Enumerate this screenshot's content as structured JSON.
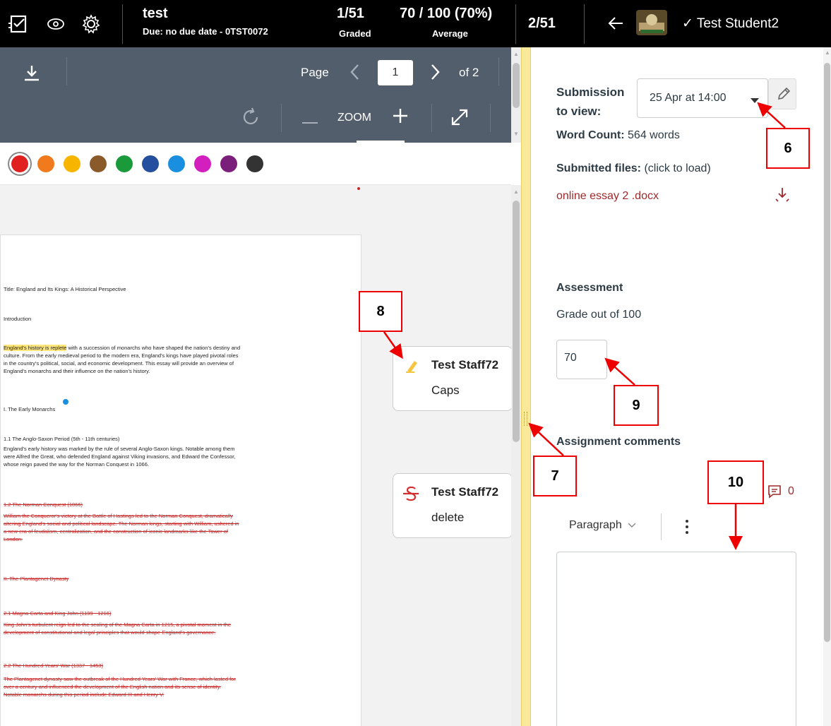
{
  "topbar": {
    "icons": [
      "gradebook-icon",
      "eye-icon",
      "gear-icon"
    ],
    "assignment_title": "test",
    "due_text": "Due: no due date - 0TST0072",
    "graded_count": "1/51",
    "graded_label": "Graded",
    "average_value": "70 / 100 (70%)",
    "average_label": "Average",
    "student_index": "2/51",
    "student_name": "✓ Test Student2"
  },
  "viewer": {
    "page_label": "Page",
    "page_value": "1",
    "page_of": "of 2",
    "zoom_label": "ZOOM",
    "palette_colors": [
      "#e02020",
      "#f07a1c",
      "#f7b500",
      "#8b5a2b",
      "#1a9a3a",
      "#244e9e",
      "#1a8fe0",
      "#d21fbe",
      "#7a1f7a",
      "#333333"
    ]
  },
  "document": {
    "lines": [
      {
        "text": "Title: England and Its Kings: A Historical Perspective",
        "style": "normal"
      },
      {
        "text": "Introduction",
        "style": "normal"
      },
      {
        "text": "England's history is replete with a succession of monarchs who have shaped the nation's destiny and",
        "style": "highlight"
      },
      {
        "text": "culture. From the early medieval period to the modern era, England's kings have played pivotal roles",
        "style": "normal"
      },
      {
        "text": "in the country's political, social, and economic development. This essay will provide an overview of",
        "style": "normal"
      },
      {
        "text": "England's monarchs and their influence on the nation's history.",
        "style": "normal"
      },
      {
        "text": "I. The Early Monarchs",
        "style": "normal"
      },
      {
        "text": "1.1 The Anglo-Saxon Period (5th - 11th centuries)",
        "style": "normal"
      },
      {
        "text": "England's early history was marked by the rule of several Anglo-Saxon kings. Notable among them",
        "style": "normal"
      },
      {
        "text": "were Alfred the Great, who defended England against Viking invasions, and Edward the Confessor,",
        "style": "normal"
      },
      {
        "text": "whose reign paved the way for the Norman Conquest in 1066.",
        "style": "normal"
      },
      {
        "text": "1.2 The Norman Conquest (1066)",
        "style": "strike"
      },
      {
        "text": "William the Conqueror's victory at the Battle of Hastings led to the Norman Conquest, dramatically",
        "style": "strike"
      },
      {
        "text": "altering England's social and political landscape. The Norman kings, starting with William, ushered in",
        "style": "strike"
      },
      {
        "text": "a new era of feudalism, centralization, and the construction of iconic landmarks like the Tower of",
        "style": "strike"
      },
      {
        "text": "London.",
        "style": "strike"
      },
      {
        "text": "II. The Plantagenet Dynasty",
        "style": "strike"
      },
      {
        "text": "2.1 Magna Carta and King John (1199 - 1216)",
        "style": "strike"
      },
      {
        "text": "King John's turbulent reign led to the sealing of the Magna Carta in 1215, a pivotal moment in the",
        "style": "strike"
      },
      {
        "text": "development of constitutional and legal principles that would shape England's governance.",
        "style": "strike"
      },
      {
        "text": "2.2 The Hundred Years' War (1337 - 1453)",
        "style": "strike"
      },
      {
        "text": "The Plantagenet dynasty saw the outbreak of the Hundred Years' War with France, which lasted for",
        "style": "strike"
      },
      {
        "text": "over a century and influenced the development of the English nation and its sense of identity.",
        "style": "strike"
      },
      {
        "text": "Notable monarchs during this period include Edward III and Henry V.",
        "style": "strike"
      }
    ]
  },
  "comments": [
    {
      "icon": "highlighter-icon",
      "author": "Test Staff72",
      "body": "Caps"
    },
    {
      "icon": "strikeout-icon",
      "author": "Test Staff72",
      "body": "delete"
    }
  ],
  "panel": {
    "submission_label": "Submission to view:",
    "submission_line1": "Submission",
    "submission_line2": "to view:",
    "submission_value": "25 Apr at 14:00",
    "word_count_label": "Word Count:",
    "word_count_value": "564 words",
    "submitted_files_label": "Submitted files:",
    "submitted_files_hint": "(click to load)",
    "file_name": "online essay 2 .docx",
    "assessment_label": "Assessment",
    "grade_out_of": "Grade out of 100",
    "grade_value": "70",
    "comments_label": "Assignment comments",
    "comment_count": "0",
    "paragraph_label": "Paragraph"
  },
  "callouts": [
    "6",
    "7",
    "8",
    "9",
    "10"
  ],
  "colors": {
    "topbar_bg": "#000000",
    "viewer_toolbar_bg": "#525e6c",
    "file_link": "#a0282a",
    "callout_border": "#ee0000",
    "splitter": "#fbe99a"
  }
}
